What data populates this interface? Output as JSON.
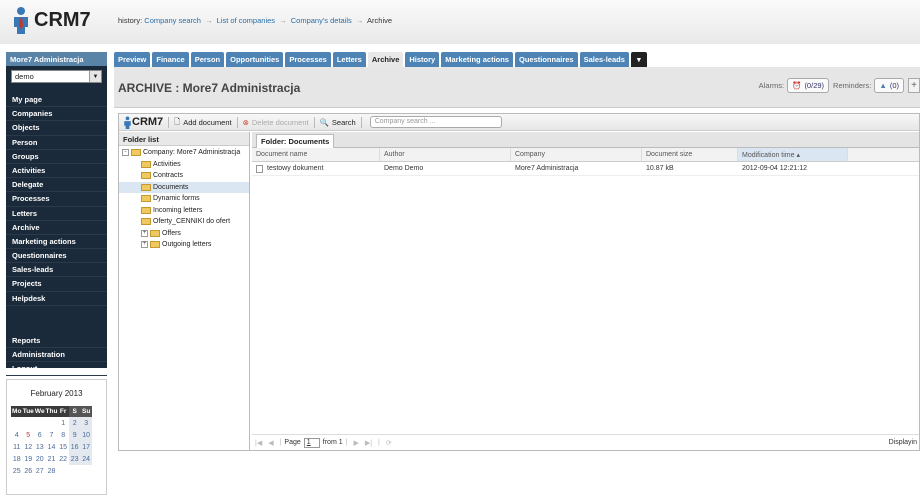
{
  "app": {
    "logo_text": "CRM7"
  },
  "history": {
    "label": "history:",
    "items": [
      "Company search",
      "List of companies",
      "Company's details",
      "Archive"
    ]
  },
  "sidebar": {
    "header": "More7 Administracja",
    "select_value": "demo",
    "items": [
      "My page",
      "Companies",
      "Objects",
      "Person",
      "Groups",
      "Activities",
      "Delegate",
      "Processes",
      "Letters",
      "Archive",
      "Marketing actions",
      "Questionnaires",
      "Sales-leads",
      "Projects",
      "Helpdesk"
    ],
    "items_bottom": [
      "Reports",
      "Administration",
      "Logout"
    ]
  },
  "calendar": {
    "title": "February 2013",
    "weekdays": [
      "Mo",
      "Tue",
      "We",
      "Thu",
      "Fr",
      "S",
      "Su"
    ],
    "weeks": [
      [
        "",
        "",
        "",
        "",
        "1",
        "2",
        "3"
      ],
      [
        "4",
        "5",
        "6",
        "7",
        "8",
        "9",
        "10"
      ],
      [
        "11",
        "12",
        "13",
        "14",
        "15",
        "16",
        "17"
      ],
      [
        "18",
        "19",
        "20",
        "21",
        "22",
        "23",
        "24"
      ],
      [
        "25",
        "26",
        "27",
        "28",
        "",
        "",
        ""
      ]
    ]
  },
  "tabs": [
    "Preview",
    "Finance",
    "Person",
    "Opportunities",
    "Processes",
    "Letters",
    "Archive",
    "History",
    "Marketing actions",
    "Questionnaires",
    "Sales-leads"
  ],
  "active_tab": "Archive",
  "page_title": "ARCHIVE : More7 Administracja",
  "alarms": {
    "label": "Alarms:",
    "value": "(0/29)",
    "reminders_label": "Reminders:",
    "reminders_value": "(0)"
  },
  "toolbar": {
    "logo_text": "CRM7",
    "add_document": "Add document",
    "delete_document": "Delete document",
    "search": "Search",
    "search_placeholder": "Company search ..."
  },
  "folder_list": {
    "header": "Folder list",
    "tree": [
      {
        "label": "Company: More7 Administracja",
        "level": 0,
        "expander": "-"
      },
      {
        "label": "Activities",
        "level": 1,
        "expander": ""
      },
      {
        "label": "Contracts",
        "level": 1,
        "expander": ""
      },
      {
        "label": "Documents",
        "level": 1,
        "expander": "",
        "selected": true
      },
      {
        "label": "Dynamic forms",
        "level": 1,
        "expander": ""
      },
      {
        "label": "Incoming letters",
        "level": 1,
        "expander": ""
      },
      {
        "label": "Oferty_CENNIKI do ofert",
        "level": 1,
        "expander": ""
      },
      {
        "label": "Offers",
        "level": 1,
        "expander": "+"
      },
      {
        "label": "Outgoing letters",
        "level": 1,
        "expander": "+"
      }
    ]
  },
  "documents": {
    "tab_label": "Folder: Documents",
    "columns": [
      "Document name",
      "Author",
      "Company",
      "Document size",
      "Modification time ▴"
    ],
    "rows": [
      [
        "testowy dokument",
        "Demo Demo",
        "More7 Administracja",
        "10.87 kB",
        "2012-09-04 12:21:12"
      ]
    ]
  },
  "pager": {
    "page_label": "Page",
    "page_value": "1",
    "of_label": "from 1",
    "displaying": "Displayin"
  },
  "colors": {
    "tab_blue": "#4d84b5",
    "sidebar_dark": "#1b2a3a",
    "sidebar_head": "#5a83a8"
  }
}
